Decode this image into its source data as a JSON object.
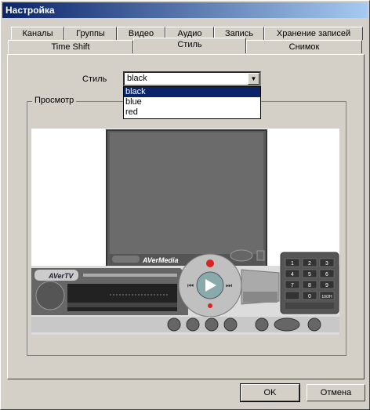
{
  "window": {
    "title": "Настройка"
  },
  "tabs_row1": [
    "Каналы",
    "Группы",
    "Видео",
    "Аудио",
    "Запись",
    "Хранение записей"
  ],
  "tabs_row2": [
    "Time Shift",
    "Стиль",
    "Снимок"
  ],
  "style": {
    "label": "Стиль",
    "selected": "black",
    "options": [
      "black",
      "blue",
      "red"
    ]
  },
  "preview": {
    "title": "Просмотр",
    "brand": "AVerMedia",
    "logo": "AVerTV",
    "keypad": [
      "1",
      "2",
      "3",
      "4",
      "5",
      "6",
      "7",
      "8",
      "9",
      "0",
      "10/2H"
    ]
  },
  "buttons": {
    "ok": "OK",
    "cancel": "Отмена"
  }
}
